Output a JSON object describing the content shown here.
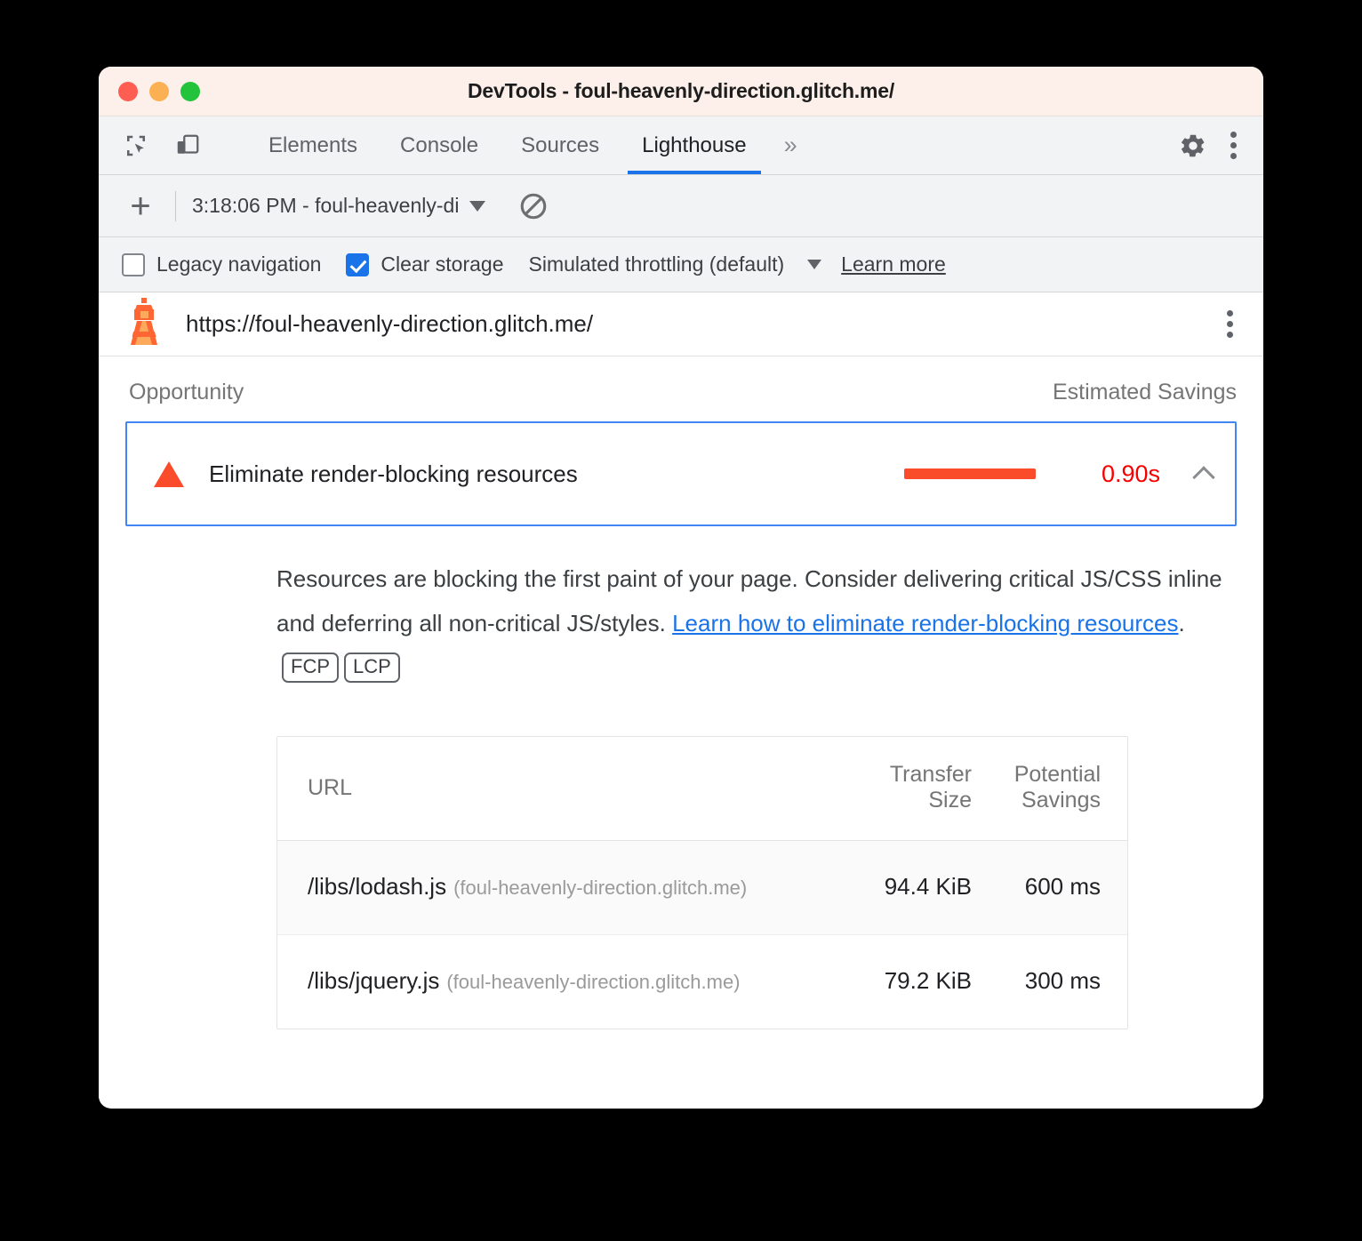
{
  "window": {
    "title": "DevTools - foul-heavenly-direction.glitch.me/"
  },
  "tabstrip": {
    "inspect_icon": "inspect-element-icon",
    "device_icon": "device-toolbar-icon",
    "tabs": [
      {
        "label": "Elements",
        "active": false
      },
      {
        "label": "Console",
        "active": false
      },
      {
        "label": "Sources",
        "active": false
      },
      {
        "label": "Lighthouse",
        "active": true
      }
    ],
    "more_tabs": "»",
    "settings_icon": "gear-icon",
    "menu_icon": "more-vertical-icon"
  },
  "runbar": {
    "new_run_label": "+",
    "selected_run": "3:18:06 PM - foul-heavenly-di",
    "clear_icon": "no-entry-clear-icon"
  },
  "options": {
    "legacy_navigation": {
      "label": "Legacy navigation",
      "checked": false
    },
    "clear_storage": {
      "label": "Clear storage",
      "checked": true
    },
    "throttling": "Simulated throttling (default)",
    "learn_more": "Learn more"
  },
  "report_header": {
    "lighthouse_icon": "lighthouse-icon",
    "url": "https://foul-heavenly-direction.glitch.me/",
    "menu_icon": "more-vertical-icon"
  },
  "columns": {
    "opportunity": "Opportunity",
    "estimated_savings": "Estimated Savings"
  },
  "opportunity": {
    "severity_icon": "warning-triangle-icon",
    "title": "Eliminate render-blocking resources",
    "savings": "0.90s",
    "expanded": true,
    "collapse_icon": "chevron-up-icon",
    "bar_color": "#fa4b2a",
    "savings_color": "#f80000"
  },
  "description": {
    "part1": "Resources are blocking the first paint of your page. Consider delivering critical JS/CSS inline and deferring all non-critical JS/styles. ",
    "link_text": "Learn how to eliminate render-blocking resources",
    "part2": ".",
    "badges": [
      "FCP",
      "LCP"
    ]
  },
  "table": {
    "headers": {
      "url": "URL",
      "transfer_size_line1": "Transfer",
      "transfer_size_line2": "Size",
      "potential_savings_line1": "Potential",
      "potential_savings_line2": "Savings"
    },
    "rows": [
      {
        "url": "/libs/lodash.js",
        "origin": "(foul-heavenly-direction.glitch.me)",
        "transfer_size": "94.4 KiB",
        "potential_savings": "600 ms"
      },
      {
        "url": "/libs/jquery.js",
        "origin": "(foul-heavenly-direction.glitch.me)",
        "transfer_size": "79.2 KiB",
        "potential_savings": "300 ms"
      }
    ]
  }
}
